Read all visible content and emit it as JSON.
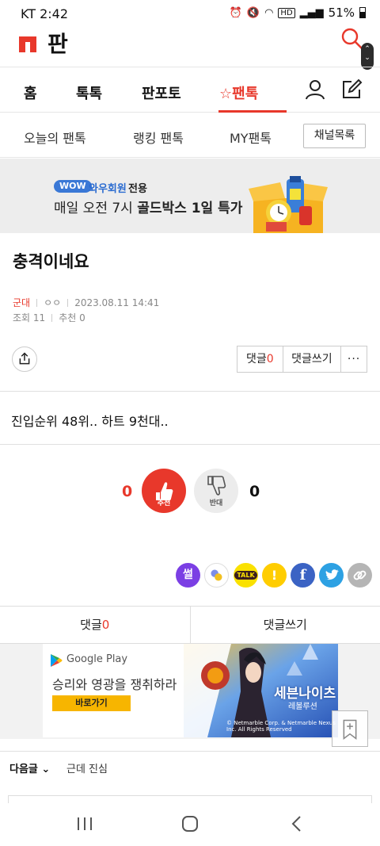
{
  "status_bar": {
    "carrier_time": "KT 2:42",
    "hd": "HD",
    "battery": "51%"
  },
  "app": {
    "title": "판",
    "brand_color": "#e8382b"
  },
  "tabs": [
    {
      "label": "홈"
    },
    {
      "label": "톡톡"
    },
    {
      "label": "판포토"
    },
    {
      "label": "☆팬톡",
      "active": true
    }
  ],
  "subnav": {
    "items": [
      "오늘의 팬톡",
      "랭킹 팬톡",
      "MY팬톡"
    ],
    "channel_button": "채널목록"
  },
  "banner": {
    "badge": "WOW",
    "member": "와우회원",
    "only": "전용",
    "line2_prefix": "매일 오전 7시 ",
    "line2_bold": "골드박스 1일 특가"
  },
  "post": {
    "title": "충격이네요",
    "category": "군대",
    "author": "ㅇㅇ",
    "datetime": "2023.08.11 14:41",
    "views_label": "조회",
    "views": "11",
    "recommend_label": "추천",
    "recommend": "0",
    "body": "진입순위 48위.. 하트 9천대..",
    "comment_label": "댓글",
    "comment_count": "0",
    "write_comment": "댓글쓰기",
    "more": "···"
  },
  "votes": {
    "up_count": "0",
    "up_label": "추천",
    "down_label": "반대",
    "down_count": "0"
  },
  "share_icons": [
    {
      "name": "ssul",
      "glyph": "썰",
      "color": "#7b3fe4"
    },
    {
      "name": "band",
      "glyph": "",
      "color": "#ffffff"
    },
    {
      "name": "kakaotalk",
      "glyph": "TALK",
      "color": "#fae100"
    },
    {
      "name": "kakaostory",
      "glyph": "!",
      "color": "#ffcd00"
    },
    {
      "name": "facebook",
      "glyph": "f",
      "color": "#3b63c4"
    },
    {
      "name": "twitter",
      "glyph": "",
      "color": "#2da1e3"
    },
    {
      "name": "link",
      "glyph": "",
      "color": "#b5b5b5"
    }
  ],
  "comment_bar": {
    "left_label": "댓글",
    "left_count": "0",
    "right_label": "댓글쓰기"
  },
  "ad": {
    "store": "Google Play",
    "headline": "승리와 영광을 쟁취하라",
    "cta": "바로가기",
    "game_title": "세븐나이츠",
    "game_sub": "레볼루션",
    "copyright": "© Netmarble Corp. & Netmarble Nexus Inc. All Rights Reserved"
  },
  "next_post": {
    "label": "다음글",
    "title": "근데 진심"
  }
}
